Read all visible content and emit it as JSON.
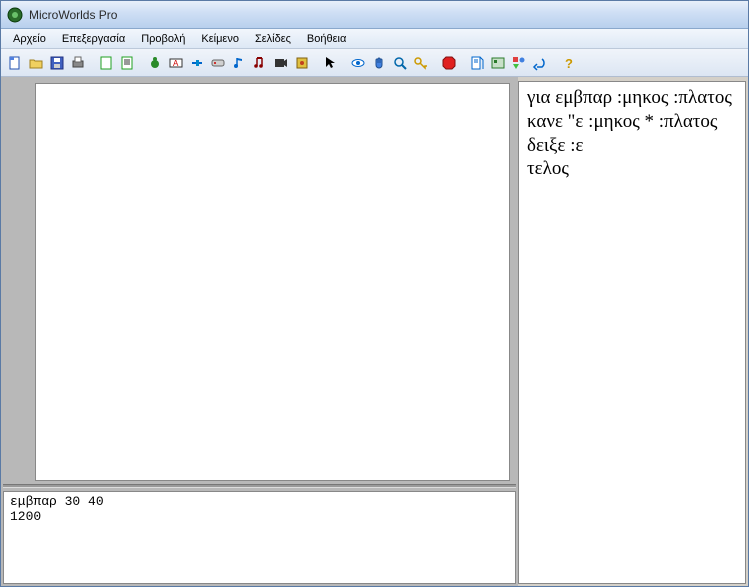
{
  "window": {
    "title": "MicroWorlds Pro"
  },
  "menus": {
    "file": "Αρχείο",
    "edit": "Επεξεργασία",
    "view": "Προβολή",
    "text": "Κείμενο",
    "pages": "Σελίδες",
    "help": "Βοήθεια"
  },
  "toolbar_icons": {
    "new": "new-file-icon",
    "open": "open-file-icon",
    "save": "save-icon",
    "print": "print-icon",
    "page1": "page-icon",
    "page2": "page-text-icon",
    "turtle": "turtle-icon",
    "textbox": "textbox-icon",
    "slider": "slider-icon",
    "button": "button-icon",
    "music": "music-icon",
    "melody": "melody-icon",
    "video": "video-icon",
    "stamp": "stamp-icon",
    "pointer": "pointer-icon",
    "eye": "eye-icon",
    "hand": "hand-icon",
    "magnify": "magnifier-icon",
    "key": "key-icon",
    "stop": "stop-icon",
    "procs": "procedures-icon",
    "project": "project-icon",
    "shapes": "shapes-icon",
    "undo": "undo-icon",
    "help": "help-icon"
  },
  "command_center": {
    "content": "εμβπαρ 30 40\n1200"
  },
  "procedures": {
    "content": "για εμβπαρ :μηκος :πλατος\nκανε \"ε :μηκος * :πλατος\nδειξε :ε\nτελος"
  }
}
